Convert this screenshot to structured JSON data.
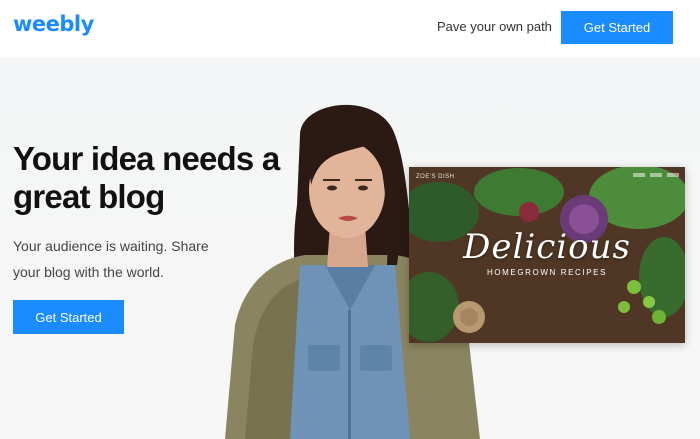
{
  "header": {
    "logo": "weebly",
    "nav_link": "Pave your own path",
    "cta": "Get Started"
  },
  "hero": {
    "headline": "Your idea needs a great blog",
    "subtitle": "Your audience is waiting. Share your blog with the world.",
    "cta": "Get Started"
  },
  "preview": {
    "site_name": "ZOE'S DISH",
    "title": "Delicious",
    "subtitle": "HOMEGROWN RECIPES"
  },
  "colors": {
    "accent": "#1a8cff",
    "text_dark": "#111111",
    "text_muted": "#444444"
  }
}
